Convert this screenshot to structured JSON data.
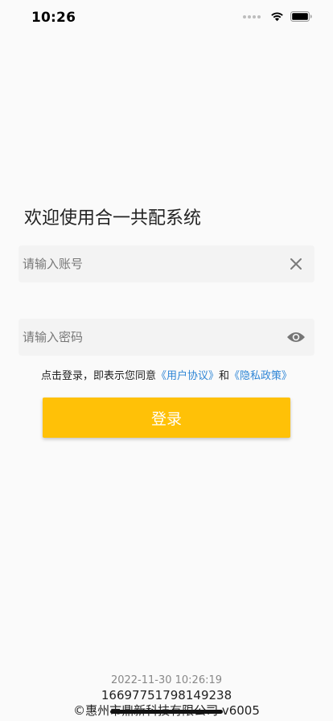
{
  "status_bar": {
    "time": "10:26"
  },
  "login": {
    "welcome_text": "欢迎使用合一共配系统",
    "account_placeholder": "请输入账号",
    "account_value": "",
    "password_placeholder": "请输入密码",
    "password_value": "",
    "agreement_prefix": "点击登录，即表示您同意",
    "user_agreement_link": "《用户协议》",
    "agreement_conjunction": "和",
    "privacy_policy_link": "《隐私政策》",
    "login_button_label": "登录"
  },
  "footer": {
    "date": "2022-11-30 10:26:19",
    "id": "1669775179814923​8",
    "copyright": "©惠州市鼎新科技有限公司 v6005"
  },
  "icons": {
    "clear": "close-icon",
    "visibility": "eye-icon",
    "wifi": "wifi-icon",
    "battery": "battery-icon"
  },
  "colors": {
    "background": "#fafafa",
    "field_background": "#f3f3f3",
    "accent": "#ffc107",
    "link": "#2f86d6"
  }
}
